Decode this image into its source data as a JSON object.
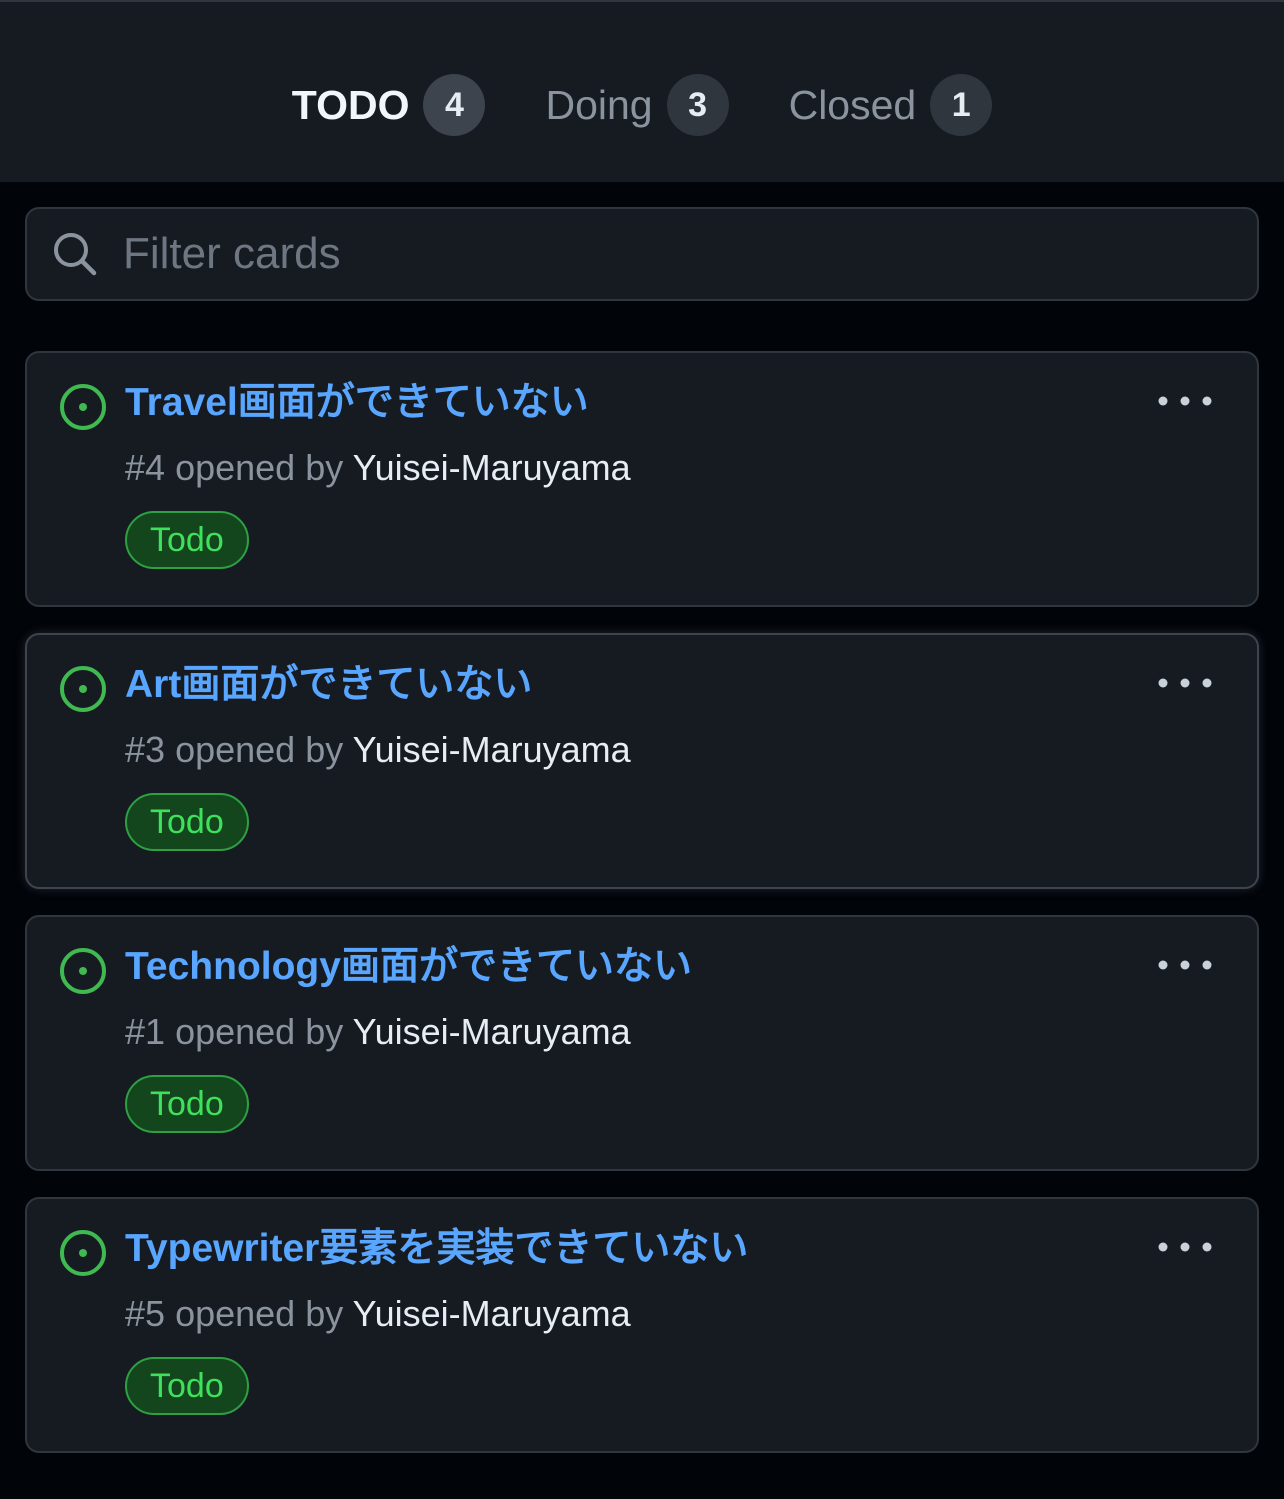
{
  "tabs": [
    {
      "label": "TODO",
      "count": "4",
      "active": true
    },
    {
      "label": "Doing",
      "count": "3",
      "active": false
    },
    {
      "label": "Closed",
      "count": "1",
      "active": false
    }
  ],
  "search": {
    "placeholder": "Filter cards",
    "value": ""
  },
  "cards": [
    {
      "title": "Travel画面ができていない",
      "number": "#4",
      "opened_by_text": "opened by",
      "author": "Yuisei-Maruyama",
      "label": "Todo",
      "icon": "issue-opened-icon"
    },
    {
      "title": "Art画面ができていない",
      "number": "#3",
      "opened_by_text": "opened by",
      "author": "Yuisei-Maruyama",
      "label": "Todo",
      "icon": "issue-opened-icon"
    },
    {
      "title": "Technology画面ができていない",
      "number": "#1",
      "opened_by_text": "opened by",
      "author": "Yuisei-Maruyama",
      "label": "Todo",
      "icon": "issue-opened-icon"
    },
    {
      "title": "Typewriter要素を実装できていない",
      "number": "#5",
      "opened_by_text": "opened by",
      "author": "Yuisei-Maruyama",
      "label": "Todo",
      "icon": "issue-opened-icon"
    }
  ],
  "icons": {
    "search": "search-icon",
    "more": "kebab-horizontal-icon"
  },
  "colors": {
    "background": "#010409",
    "surface": "#161b22",
    "border": "#30363d",
    "link": "#58a6ff",
    "open_issue": "#3fb950",
    "label_text": "#3fe05c",
    "label_bg": "#13461d",
    "muted_text": "#8b949e",
    "primary_text": "#e6edf3"
  }
}
